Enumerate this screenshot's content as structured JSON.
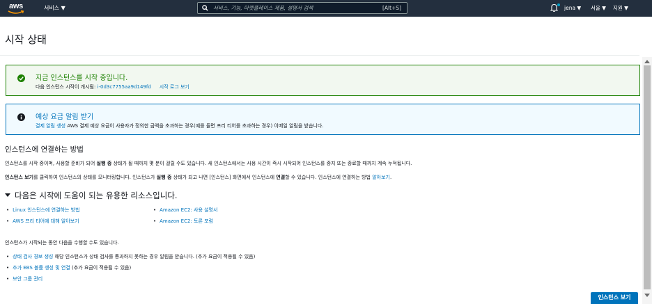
{
  "topbar": {
    "logo_text": "aws",
    "services_label": "서비스 ▼",
    "search_placeholder": "서비스, 기능, 마켓플레이스 제품, 설명서 검색",
    "search_shortcut": "[Alt+S]",
    "user_label": "jena ▼",
    "region_label": "서울 ▼",
    "support_label": "지원 ▼"
  },
  "page": {
    "title": "시작 상태"
  },
  "success_alert": {
    "heading": "지금 인스턴스를 시작 중입니다.",
    "text_prefix": "다음 인스턴스 시작이 개시됨: ",
    "instance_id": "i-0d3c7755aa9d149fd",
    "log_link": "시작 로그 보기"
  },
  "info_alert": {
    "heading": "예상 요금 알림 받기",
    "link": "결제 알림 생성",
    "text": " AWS 결제 예상 요금이 사용자가 정의한 금액을 초과하는 경우(예를 들면 프리 티어를 초과하는 경우) 이메일 알림을 받습니다."
  },
  "connect_section": {
    "heading": "인스턴스에 연결하는 방법",
    "p1_a": "인스턴스를 시작 중이며, 사용할 준비가 되어 ",
    "p1_bold": "실행 중",
    "p1_b": " 상태가 될 때까지 몇 분이 걸릴 수도 있습니다. 새 인스턴스에서는 사용 시간이 즉시 시작되어 인스턴스를 중지 또는 종료할 때까지 계속 누적됩니다.",
    "p2_bold1": "인스턴스 보기",
    "p2_a": "를 클릭하여 인스턴스의 상태를 모니터링합니다. 인스턴스가 ",
    "p2_bold2": "실행 중",
    "p2_b": " 상태가 되고 나면 [인스턴스] 화면에서 인스턴스에 ",
    "p2_bold3": "연결",
    "p2_c": "할 수 있습니다. 인스턴스에 연결하는 방법 ",
    "p2_link": "알아보기",
    "p2_end": "."
  },
  "resources": {
    "heading": "다음은 시작에 도움이 되는 유용한 리소스입니다.",
    "links": [
      "Linux 인스턴스에 연결하는 방법",
      "AWS 프리 티어에 대해 알아보기",
      "Amazon EC2: 사용 설명서",
      "Amazon EC2: 토론 포럼"
    ]
  },
  "todo": {
    "intro": "인스턴스가 시작되는 동안 다음을 수행할 수도 있습니다.",
    "item1_link": "상태 검사 경보 생성",
    "item1_text": " 해당 인스턴스가 상태 검사를 통과하지 못하는 경우 알림을 받습니다. (추가 요금이 적용될 수 있음)",
    "item2_link": "추가 EBS 볼륨 생성 및 연결",
    "item2_text": " (추가 요금이 적용될 수 있음)",
    "item3_link": "보안 그룹 관리"
  },
  "footer": {
    "view_instances_button": "인스턴스 보기"
  },
  "colors": {
    "topbar": "#232f3e",
    "link": "#0073bb",
    "success": "#1d8102",
    "primary_button": "#0073bb"
  }
}
